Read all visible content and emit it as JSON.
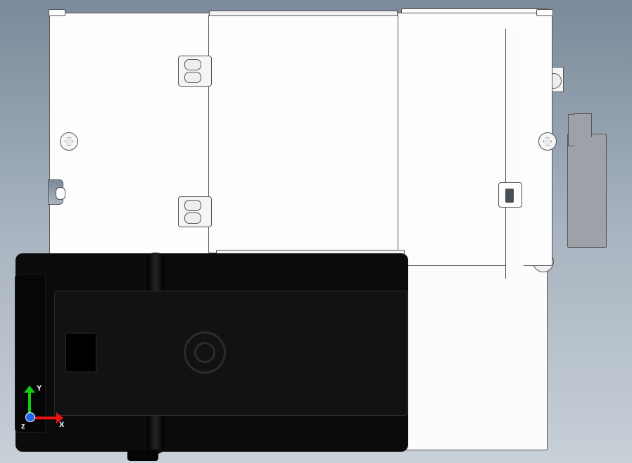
{
  "axes": {
    "x_label": "X",
    "y_label": "Y",
    "z_label": "z"
  },
  "colors": {
    "x_axis": "#e11111",
    "y_axis": "#11cc11",
    "z_axis": "#2266ee",
    "body_fill": "#fdfdfd",
    "motor_fill": "#0b0b0c",
    "bracket_fill": "#9ea2a8"
  }
}
